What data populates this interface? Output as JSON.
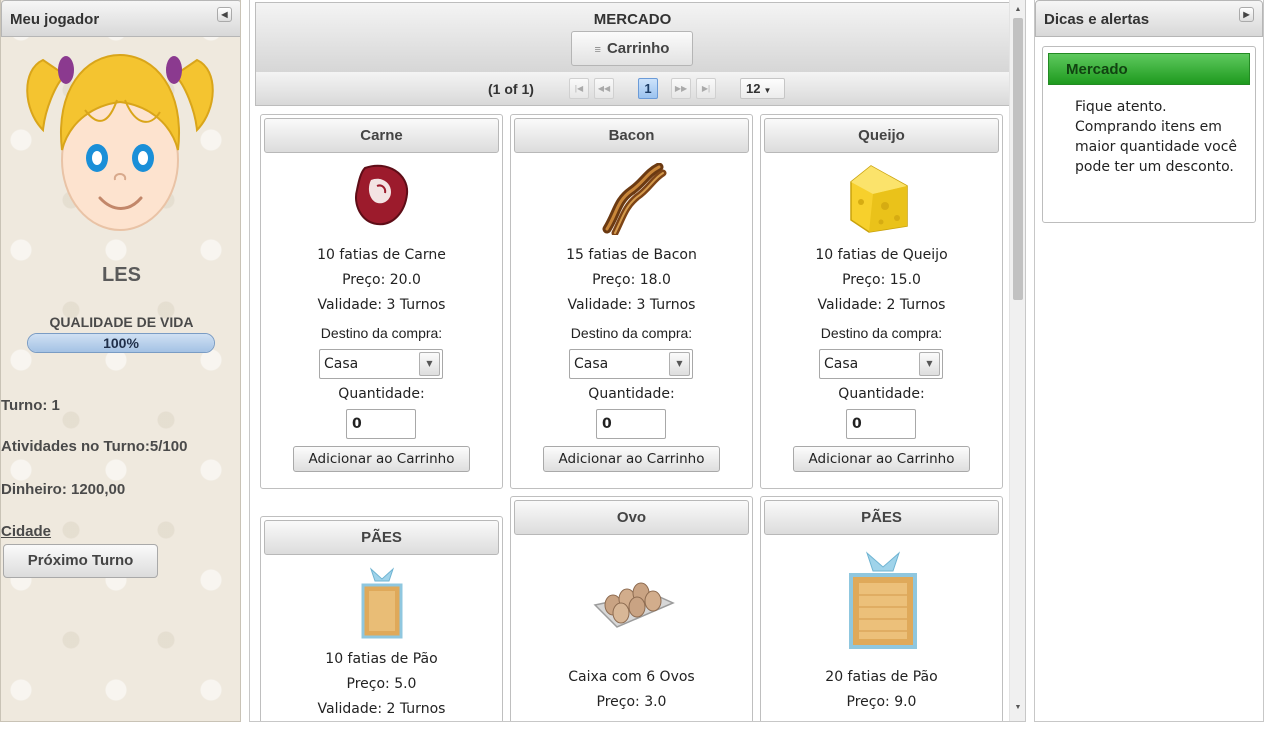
{
  "player": {
    "panel_title": "Meu jogador",
    "name": "LES",
    "quality_label": "QUALIDADE DE VIDA",
    "quality_value": "100%",
    "quality_fraction": 1.0,
    "turn": "Turno: 1",
    "activities": "Atividades no Turno:5/100",
    "money": "Dinheiro: 1200,00",
    "city_link": "Cidade",
    "next_turn_button": "Próximo Turno"
  },
  "market": {
    "title": "MERCADO",
    "cart_button": "Carrinho",
    "pagination": {
      "info": "(1 of 1)",
      "current_page": "1",
      "rows_per_page": "12"
    },
    "products": [
      {
        "name": "Carne",
        "description": "10 fatias de Carne",
        "price": "Preço: 20.0",
        "validity": "Validade: 3 Turnos",
        "destination_label": "Destino da compra:",
        "destination": "Casa",
        "quantity_label": "Quantidade:",
        "quantity": "0",
        "add_button": "Adicionar ao Carrinho"
      },
      {
        "name": "Bacon",
        "description": "15 fatias de Bacon",
        "price": "Preço: 18.0",
        "validity": "Validade: 3 Turnos",
        "destination_label": "Destino da compra:",
        "destination": "Casa",
        "quantity_label": "Quantidade:",
        "quantity": "0",
        "add_button": "Adicionar ao Carrinho"
      },
      {
        "name": "Queijo",
        "description": "10 fatias de Queijo",
        "price": "Preço: 15.0",
        "validity": "Validade: 2 Turnos",
        "destination_label": "Destino da compra:",
        "destination": "Casa",
        "quantity_label": "Quantidade:",
        "quantity": "0",
        "add_button": "Adicionar ao Carrinho"
      },
      {
        "name": "PÃES",
        "description": "10 fatias de Pão",
        "price": "Preço: 5.0",
        "validity": "Validade: 2 Turnos"
      },
      {
        "name": "Ovo",
        "description": "Caixa com 6 Ovos",
        "price": "Preço: 3.0"
      },
      {
        "name": "PÃES",
        "description": "20 fatias de Pão",
        "price": "Preço: 9.0"
      }
    ]
  },
  "tips": {
    "panel_title": "Dicas e alertas",
    "alert_title": "Mercado",
    "alert_text": "Fique atento. Comprando itens em maior quantidade você pode ter um desconto."
  },
  "icons": {
    "collapse_left": "triangle-left-icon",
    "collapse_right": "triangle-right-icon",
    "cart": "cart-icon"
  }
}
